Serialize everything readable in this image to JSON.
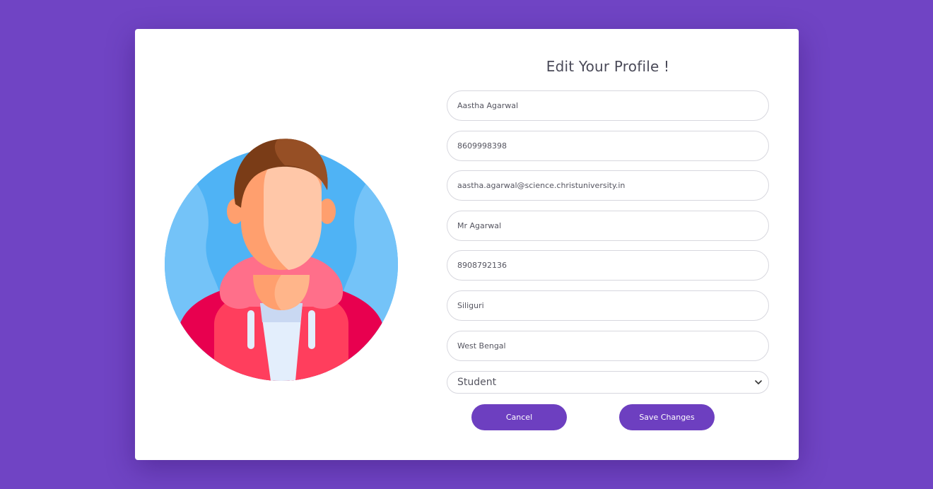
{
  "page": {
    "title": "Edit Your Profile !",
    "background_color": "#7044c4",
    "accent_color": "#6d3fc0"
  },
  "avatar": {
    "icon": "user-avatar-illustration"
  },
  "fields": {
    "name": "Aastha Agarwal",
    "phone": "8609998398",
    "email": "aastha.agarwal@science.christuniversity.in",
    "guardian_name": "Mr Agarwal",
    "guardian_phone": "8908792136",
    "city": "Siliguri",
    "state": "West Bengal",
    "role": "Student"
  },
  "actions": {
    "cancel_label": "Cancel",
    "save_label": "Save Changes"
  }
}
